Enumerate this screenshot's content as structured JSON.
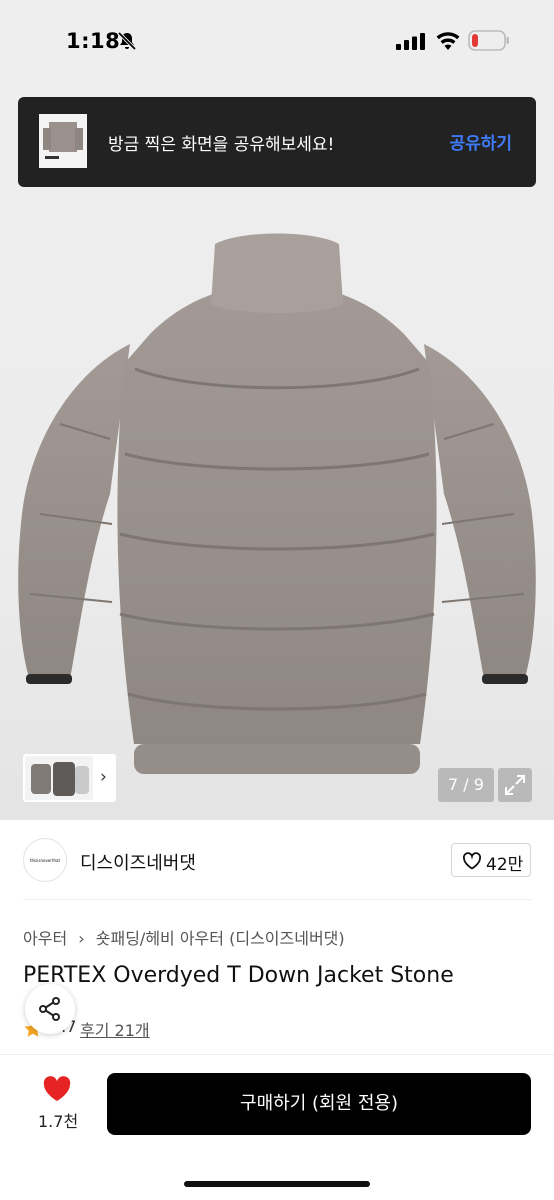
{
  "status_bar": {
    "time": "1:18"
  },
  "banner": {
    "message": "방금 찍은 화면을 공유해보세요!",
    "action": "공유하기"
  },
  "gallery": {
    "counter": "7 / 9"
  },
  "brand": {
    "logo_text": "thisisneverthat",
    "name": "디스이즈네버댓",
    "likes": "42만"
  },
  "breadcrumb": [
    "아우터",
    "숏패딩/헤비 아우터",
    "(디스이즈네버댓)"
  ],
  "product": {
    "title": "PERTEX Overdyed T Down Jacket Stone",
    "rating": "4.7",
    "reviews": "후기 21개"
  },
  "bottom_bar": {
    "wish_count": "1.7천",
    "buy_label": "구매하기 (회원 전용)"
  },
  "colors": {
    "accent_blue": "#3f7bf6",
    "heart_red": "#e62424",
    "star": "#f5a623",
    "jacket": "#9a918c"
  },
  "icons": [
    "bell-slash-icon",
    "signal-icon",
    "wifi-icon",
    "battery-icon",
    "chevron-right-icon",
    "expand-icon",
    "heart-outline-icon",
    "star-icon",
    "share-icon",
    "heart-filled-icon"
  ]
}
